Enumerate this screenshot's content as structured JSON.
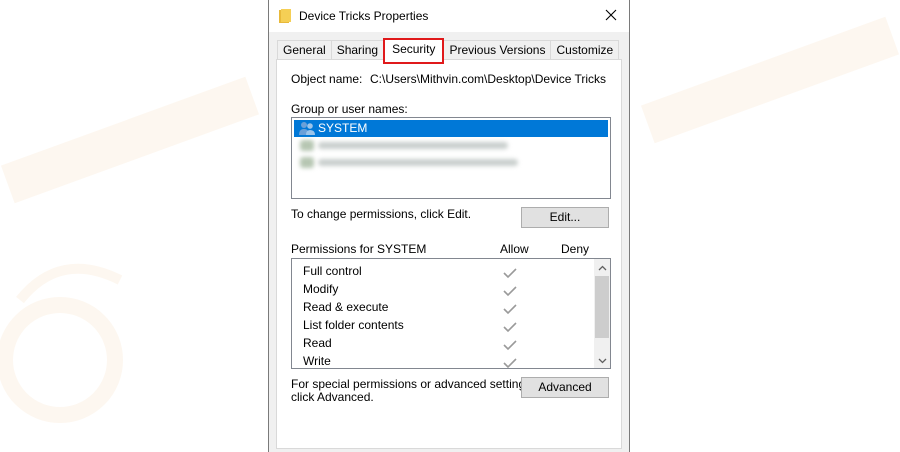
{
  "window": {
    "title": "Device Tricks Properties"
  },
  "tabs": [
    {
      "label": "General"
    },
    {
      "label": "Sharing"
    },
    {
      "label": "Security"
    },
    {
      "label": "Previous Versions"
    },
    {
      "label": "Customize"
    }
  ],
  "active_tab": "Security",
  "security": {
    "object_name_label": "Object name:",
    "object_name_value": "C:\\Users\\Mithvin.com\\Desktop\\Device Tricks",
    "group_label": "Group or user names:",
    "users": [
      {
        "name": "SYSTEM",
        "selected": true
      },
      {
        "name": "",
        "selected": false,
        "blurred": true
      },
      {
        "name": "",
        "selected": false,
        "blurred": true
      }
    ],
    "change_text": "To change permissions, click Edit.",
    "edit_button": "Edit...",
    "permissions_label": "Permissions for SYSTEM",
    "allow_header": "Allow",
    "deny_header": "Deny",
    "permissions": [
      {
        "name": "Full control",
        "allow": true,
        "deny": false
      },
      {
        "name": "Modify",
        "allow": true,
        "deny": false
      },
      {
        "name": "Read & execute",
        "allow": true,
        "deny": false
      },
      {
        "name": "List folder contents",
        "allow": true,
        "deny": false
      },
      {
        "name": "Read",
        "allow": true,
        "deny": false
      },
      {
        "name": "Write",
        "allow": true,
        "deny": false
      }
    ],
    "special_text_line1": "For special permissions or advanced settings,",
    "special_text_line2": "click Advanced.",
    "advanced_button": "Advanced"
  },
  "colors": {
    "selection": "#0078d7",
    "highlight_border": "#e0191b",
    "check_grey": "#9a9a9a"
  },
  "icons": {
    "title": "folder-icon",
    "close": "close-icon",
    "user": "users-icon",
    "check": "check-icon",
    "scroll_up": "chevron-up-icon",
    "scroll_down": "chevron-down-icon"
  }
}
